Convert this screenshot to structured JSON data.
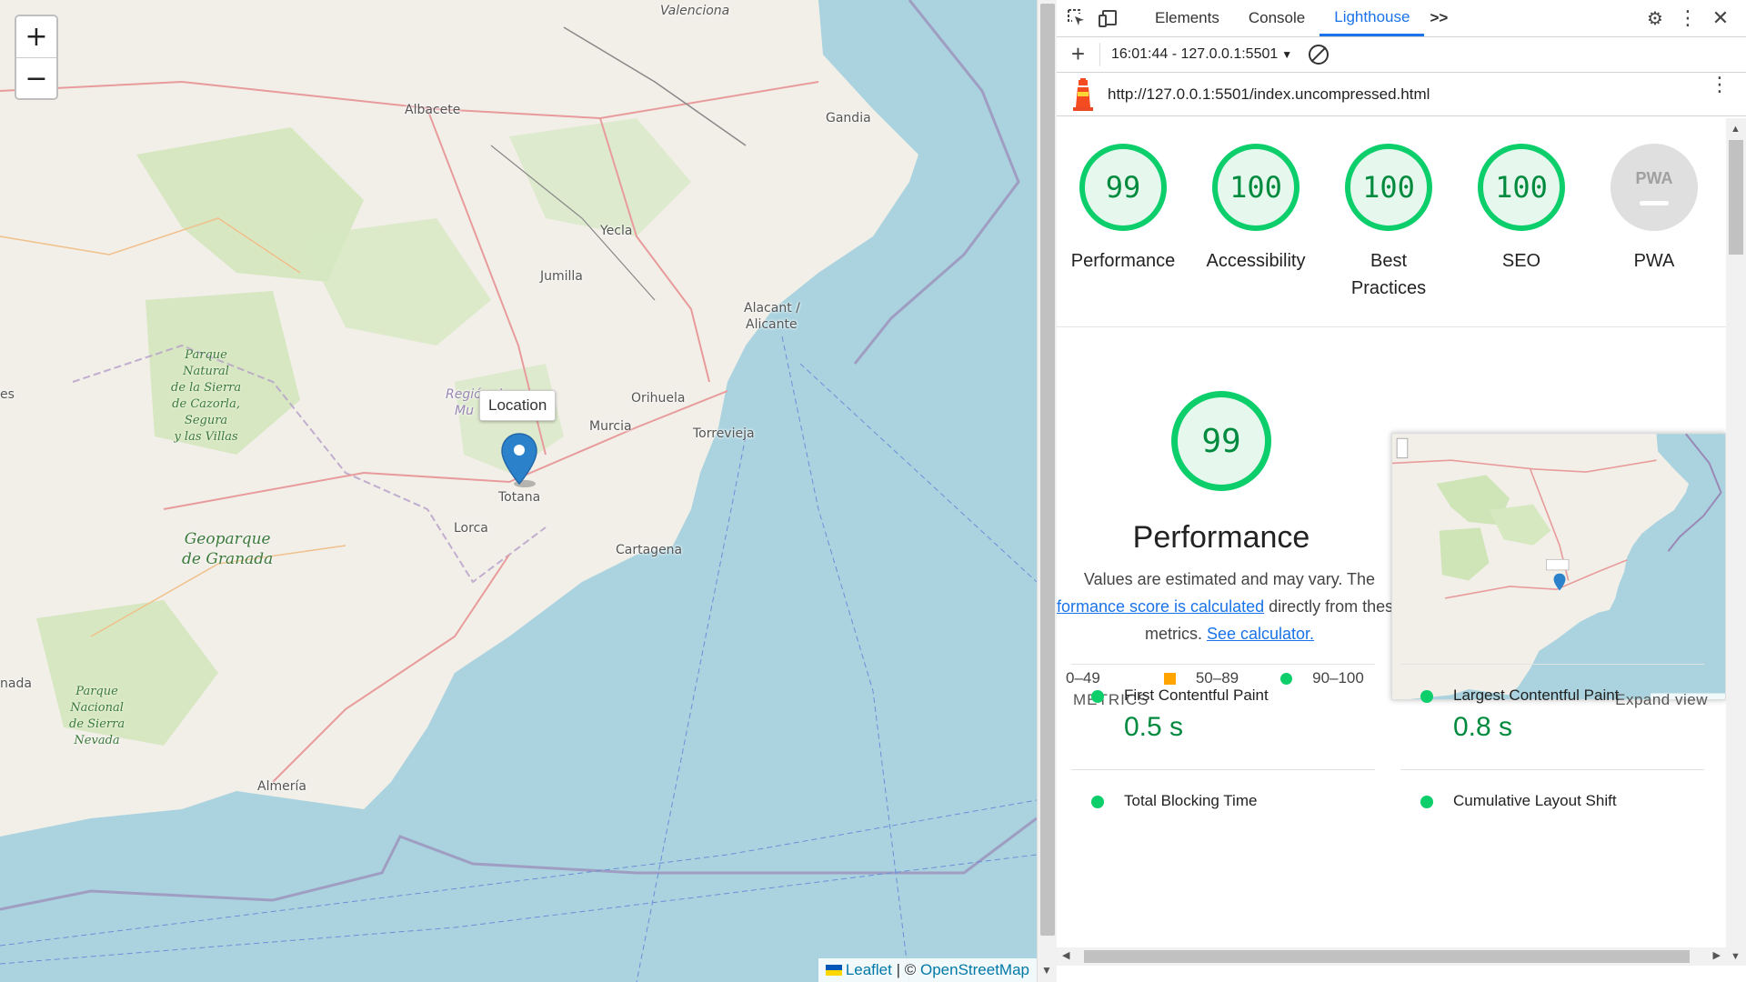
{
  "map": {
    "zoom_in": "+",
    "zoom_out": "−",
    "places": {
      "valenciona": "Valenciona",
      "albacete": "Albacete",
      "gandia": "Gandia",
      "yecla": "Yecla",
      "jumilla": "Jumilla",
      "alacant": "Alacant /",
      "alicante": "Alicante",
      "region_1": "Región de",
      "region_2": "Mu",
      "orihuela": "Orihuela",
      "murcia": "Murcia",
      "torrevieja": "Torrevieja",
      "totana": "Totana",
      "lorca": "Lorca",
      "cartagena": "Cartagena",
      "almeria": "Almería",
      "es": "es",
      "nada": "nada"
    },
    "parks": {
      "cazorla": "Parque\nNatural\nde la Sierra\nde Cazorla,\nSegura\ny las Villas",
      "granada": "Geoparque\nde Granada",
      "nevada": "Parque\nNacional\nde Sierra\nNevada"
    },
    "tooltip": "Location",
    "attribution": {
      "leaflet": "Leaflet",
      "sep": " | © ",
      "osm": "OpenStreetMap"
    }
  },
  "devtools": {
    "tabs": [
      "Elements",
      "Console",
      "Lighthouse"
    ],
    "more_tabs": ">>",
    "report_selector": "16:01:44 - 127.0.0.1:5501",
    "url": "http://127.0.0.1:5501/index.uncompressed.html",
    "categories": [
      {
        "score": "99",
        "label": "Performance"
      },
      {
        "score": "100",
        "label": "Accessibility"
      },
      {
        "score": "100",
        "label": "Best Practices"
      },
      {
        "score": "100",
        "label": "SEO"
      },
      {
        "score": "PWA",
        "label": "PWA"
      }
    ],
    "perf": {
      "score": "99",
      "title": "Performance",
      "desc_1": "Values are estimated and may vary. The",
      "desc_link_1": "formance score is calculated",
      "desc_2": " directly from these",
      "desc_3": "metrics. ",
      "desc_link_2": "See calculator.",
      "legend": [
        "0–49",
        "50–89",
        "90–100"
      ]
    },
    "metrics": {
      "heading": "METRICS",
      "expand": "Expand view",
      "items": [
        {
          "name": "First Contentful Paint",
          "value": "0.5 s"
        },
        {
          "name": "Largest Contentful Paint",
          "value": "0.8 s"
        },
        {
          "name": "Total Blocking Time",
          "value": ""
        },
        {
          "name": "Cumulative Layout Shift",
          "value": ""
        }
      ]
    },
    "colors": {
      "pass": "#0cce6b",
      "average": "#ffa400",
      "accent": "#1a73e8"
    }
  }
}
